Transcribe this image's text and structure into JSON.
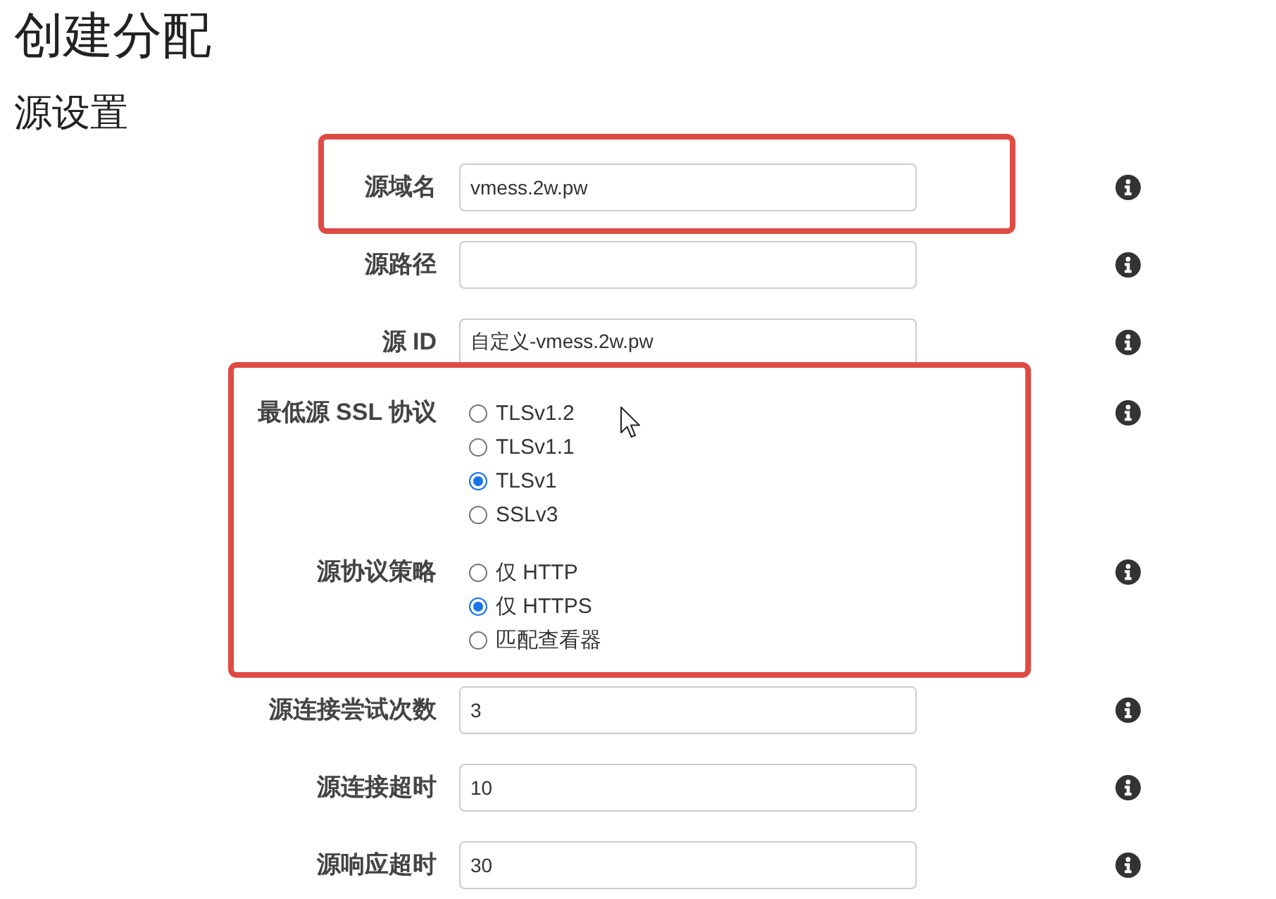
{
  "page": {
    "title": "创建分配",
    "section_title": "源设置"
  },
  "groups": [
    {
      "highlighted": true,
      "fields": [
        {
          "kind": "text",
          "label": "源域名",
          "value": "vmess.2w.pw"
        }
      ]
    },
    {
      "highlighted": false,
      "fields": [
        {
          "kind": "text",
          "label": "源路径"
        },
        {
          "kind": "text",
          "label": "源 ID",
          "value": "自定义-vmess.2w.pw"
        }
      ]
    },
    {
      "highlighted": true,
      "fields": [
        {
          "kind": "radio",
          "label": "最低源 SSL 协议",
          "options": [
            {
              "label": "TLSv1.2",
              "selected": false
            },
            {
              "label": "TLSv1.1",
              "selected": false
            },
            {
              "label": "TLSv1",
              "selected": true
            },
            {
              "label": "SSLv3",
              "selected": false
            }
          ]
        },
        {
          "kind": "radio",
          "label": "源协议策略",
          "options": [
            {
              "label": "仅 HTTP",
              "selected": false
            },
            {
              "label": "仅 HTTPS",
              "selected": true
            },
            {
              "label": "匹配查看器",
              "selected": false
            }
          ]
        }
      ]
    },
    {
      "highlighted": false,
      "fields": [
        {
          "kind": "text",
          "label": "源连接尝试次数",
          "value": "3"
        },
        {
          "kind": "text",
          "label": "源连接超时",
          "value": "10"
        },
        {
          "kind": "text",
          "label": "源响应超时",
          "value": "30"
        }
      ]
    }
  ]
}
